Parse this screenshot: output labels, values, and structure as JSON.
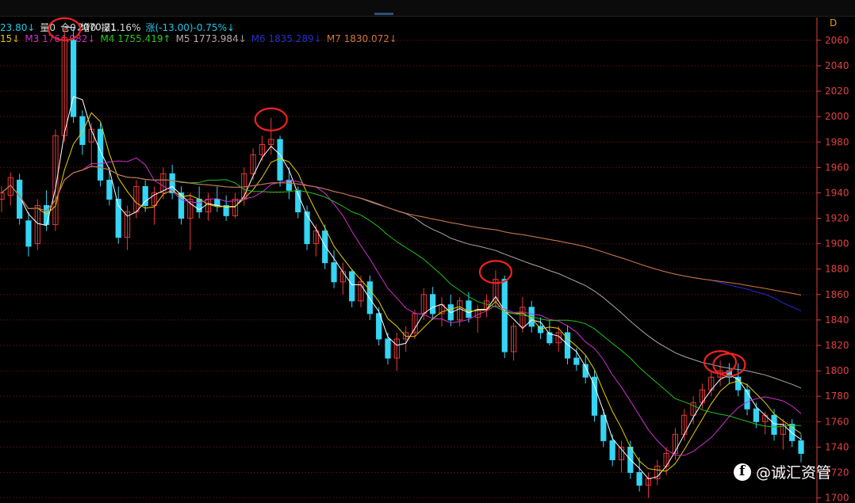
{
  "header": {
    "info_line1": [
      {
        "text": "23.80↓",
        "color": "#20c8e8"
      },
      {
        "text": "量0",
        "color": "#d8d8d8"
      },
      {
        "text": "仓0",
        "color": "#d8d8d8"
      },
      {
        "text": "增0",
        "color": "#d8d8d8"
      },
      {
        "text": "振1.16%",
        "color": "#d8d8d8"
      },
      {
        "text": "涨(-13.00)-0.75%↓",
        "color": "#20c8e8"
      }
    ],
    "ma_line": [
      {
        "text": "15↓",
        "color": "#e8d000"
      },
      {
        "text": "M3 1764.982↓",
        "color": "#d030d0"
      },
      {
        "text": "M4 1755.419↑",
        "color": "#20d020"
      },
      {
        "text": "M5 1773.984↓",
        "color": "#b0b0b0"
      },
      {
        "text": "M6 1835.289↓",
        "color": "#2030d0"
      },
      {
        "text": "M7 1830.072↓",
        "color": "#d87838"
      }
    ],
    "corner_label": "D"
  },
  "watermark": "@诚汇资管",
  "chart_data": {
    "type": "candlestick",
    "y_axis_ticks": [
      1700,
      1720,
      1740,
      1760,
      1780,
      1800,
      1820,
      1840,
      1860,
      1880,
      1900,
      1920,
      1940,
      1960,
      1980,
      2000,
      2020,
      2040,
      2060
    ],
    "ylim": [
      1696,
      2078
    ],
    "grid": true,
    "annotations": [
      {
        "text": "2070.21",
        "value": 2070.21
      }
    ],
    "highlighted_peaks": [
      2070,
      1999,
      1879,
      1808,
      1806
    ],
    "colors": {
      "up": "#e8383a",
      "down": "#35d5f5",
      "grid": "#4a0c0c",
      "axis": "#e04040",
      "highlight": "#ee2222"
    },
    "candles": [
      [
        1935,
        1945,
        1925,
        1940
      ],
      [
        1938,
        1956,
        1930,
        1952
      ],
      [
        1950,
        1955,
        1915,
        1920
      ],
      [
        1918,
        1925,
        1890,
        1898
      ],
      [
        1900,
        1935,
        1895,
        1930
      ],
      [
        1930,
        1942,
        1910,
        1915
      ],
      [
        1915,
        1990,
        1910,
        1985
      ],
      [
        1985,
        2070,
        1980,
        2062
      ],
      [
        2060,
        2070,
        1995,
        2000
      ],
      [
        2000,
        2005,
        1970,
        1978
      ],
      [
        1980,
        1995,
        1960,
        1990
      ],
      [
        1990,
        1995,
        1945,
        1950
      ],
      [
        1950,
        1960,
        1930,
        1935
      ],
      [
        1935,
        1945,
        1900,
        1905
      ],
      [
        1905,
        1930,
        1895,
        1925
      ],
      [
        1925,
        1950,
        1920,
        1945
      ],
      [
        1945,
        1950,
        1925,
        1930
      ],
      [
        1930,
        1945,
        1915,
        1940
      ],
      [
        1940,
        1960,
        1935,
        1955
      ],
      [
        1955,
        1962,
        1935,
        1940
      ],
      [
        1940,
        1945,
        1915,
        1920
      ],
      [
        1920,
        1940,
        1895,
        1935
      ],
      [
        1935,
        1945,
        1920,
        1925
      ],
      [
        1925,
        1940,
        1918,
        1935
      ],
      [
        1935,
        1945,
        1925,
        1930
      ],
      [
        1930,
        1938,
        1918,
        1922
      ],
      [
        1922,
        1940,
        1920,
        1935
      ],
      [
        1935,
        1960,
        1930,
        1955
      ],
      [
        1955,
        1975,
        1950,
        1970
      ],
      [
        1970,
        1985,
        1965,
        1978
      ],
      [
        1978,
        1999,
        1970,
        1982
      ],
      [
        1982,
        1985,
        1945,
        1950
      ],
      [
        1950,
        1960,
        1935,
        1942
      ],
      [
        1942,
        1945,
        1920,
        1925
      ],
      [
        1925,
        1930,
        1895,
        1900
      ],
      [
        1900,
        1915,
        1890,
        1910
      ],
      [
        1910,
        1915,
        1880,
        1885
      ],
      [
        1885,
        1895,
        1865,
        1870
      ],
      [
        1870,
        1885,
        1860,
        1878
      ],
      [
        1878,
        1880,
        1850,
        1855
      ],
      [
        1855,
        1875,
        1850,
        1870
      ],
      [
        1870,
        1875,
        1840,
        1845
      ],
      [
        1845,
        1850,
        1820,
        1825
      ],
      [
        1825,
        1830,
        1805,
        1810
      ],
      [
        1810,
        1830,
        1800,
        1825
      ],
      [
        1825,
        1835,
        1815,
        1830
      ],
      [
        1830,
        1848,
        1825,
        1845
      ],
      [
        1845,
        1865,
        1840,
        1860
      ],
      [
        1860,
        1866,
        1840,
        1845
      ],
      [
        1845,
        1858,
        1835,
        1852
      ],
      [
        1852,
        1860,
        1835,
        1840
      ],
      [
        1840,
        1858,
        1835,
        1855
      ],
      [
        1855,
        1862,
        1838,
        1842
      ],
      [
        1842,
        1852,
        1830,
        1848
      ],
      [
        1848,
        1860,
        1842,
        1855
      ],
      [
        1855,
        1879,
        1850,
        1872
      ],
      [
        1872,
        1875,
        1810,
        1815
      ],
      [
        1815,
        1838,
        1808,
        1835
      ],
      [
        1835,
        1858,
        1830,
        1850
      ],
      [
        1850,
        1855,
        1830,
        1835
      ],
      [
        1835,
        1842,
        1825,
        1830
      ],
      [
        1830,
        1840,
        1820,
        1822
      ],
      [
        1822,
        1835,
        1815,
        1830
      ],
      [
        1830,
        1836,
        1805,
        1810
      ],
      [
        1810,
        1818,
        1800,
        1805
      ],
      [
        1805,
        1812,
        1790,
        1795
      ],
      [
        1795,
        1800,
        1760,
        1765
      ],
      [
        1765,
        1770,
        1740,
        1745
      ],
      [
        1745,
        1750,
        1725,
        1730
      ],
      [
        1730,
        1745,
        1720,
        1740
      ],
      [
        1740,
        1745,
        1715,
        1720
      ],
      [
        1720,
        1732,
        1705,
        1710
      ],
      [
        1710,
        1720,
        1700,
        1715
      ],
      [
        1715,
        1730,
        1710,
        1725
      ],
      [
        1725,
        1740,
        1718,
        1735
      ],
      [
        1735,
        1755,
        1730,
        1750
      ],
      [
        1750,
        1770,
        1745,
        1765
      ],
      [
        1765,
        1780,
        1758,
        1775
      ],
      [
        1775,
        1790,
        1770,
        1785
      ],
      [
        1785,
        1800,
        1780,
        1795
      ],
      [
        1795,
        1808,
        1788,
        1800
      ],
      [
        1800,
        1806,
        1790,
        1795
      ],
      [
        1795,
        1806,
        1780,
        1785
      ],
      [
        1785,
        1790,
        1765,
        1770
      ],
      [
        1770,
        1775,
        1755,
        1760
      ],
      [
        1760,
        1768,
        1750,
        1765
      ],
      [
        1765,
        1770,
        1745,
        1750
      ],
      [
        1750,
        1762,
        1738,
        1758
      ],
      [
        1758,
        1762,
        1740,
        1745
      ],
      [
        1745,
        1750,
        1728,
        1735
      ]
    ]
  }
}
